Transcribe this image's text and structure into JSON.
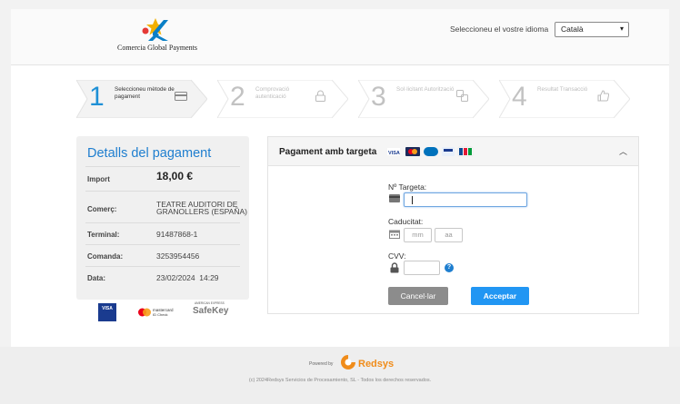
{
  "header": {
    "logo_text": "Comercia Global Payments",
    "language_label": "Seleccioneu el vostre idioma",
    "language_selected": "Català",
    "colors": {
      "logo_blue": "#0a7fc6",
      "logo_star": "#f3b000",
      "logo_dot": "#e53935"
    }
  },
  "steps": [
    {
      "number": "1",
      "label": "Seleccioneu mètode de pagament",
      "icon": "card-icon",
      "state": "active"
    },
    {
      "number": "2",
      "label": "Comprovació autenticació",
      "icon": "lock-icon",
      "state": "inactive"
    },
    {
      "number": "3",
      "label": "Sol·licitant Autorització",
      "icon": "transfer-icon",
      "state": "inactive"
    },
    {
      "number": "4",
      "label": "Resultat Transacció",
      "icon": "thumbs-up-icon",
      "state": "inactive"
    }
  ],
  "details": {
    "title": "Detalls del pagament",
    "rows": [
      {
        "label": "Import",
        "value": "18,00 €"
      },
      {
        "label": "Comerç:",
        "value": "TEATRE AUDITORI DE GRANOLLERS (ESPAÑA)"
      },
      {
        "label": "Terminal:",
        "value": "91487868-1"
      },
      {
        "label": "Comanda:",
        "value": "3253954456"
      },
      {
        "label": "Data:",
        "value": "23/02/2024  14:29"
      }
    ]
  },
  "brands": {
    "visa": "VISA",
    "mastercard": "mastercard",
    "mastercard_sub": "ID Check",
    "amex_small": "AMERICAN EXPRESS",
    "safekey": "SafeKey"
  },
  "payment": {
    "title": "Pagament amb targeta",
    "card_label": "Nº Targeta:",
    "card_value": "",
    "expiry_label": "Caducitat:",
    "month_placeholder": "mm",
    "year_placeholder": "aa",
    "cvv_label": "CVV:",
    "cancel_label": "Cancel·lar",
    "accept_label": "Acceptar",
    "card_logos": [
      "VISA",
      "mastercard",
      "diners",
      "maestro",
      "JCB"
    ]
  },
  "footer": {
    "powered_by": "Powered by",
    "brand": "Redsys",
    "copyright": "(c) 2024Redsys Servicios de Procesamiento, SL - Todos los derechos reservados."
  }
}
